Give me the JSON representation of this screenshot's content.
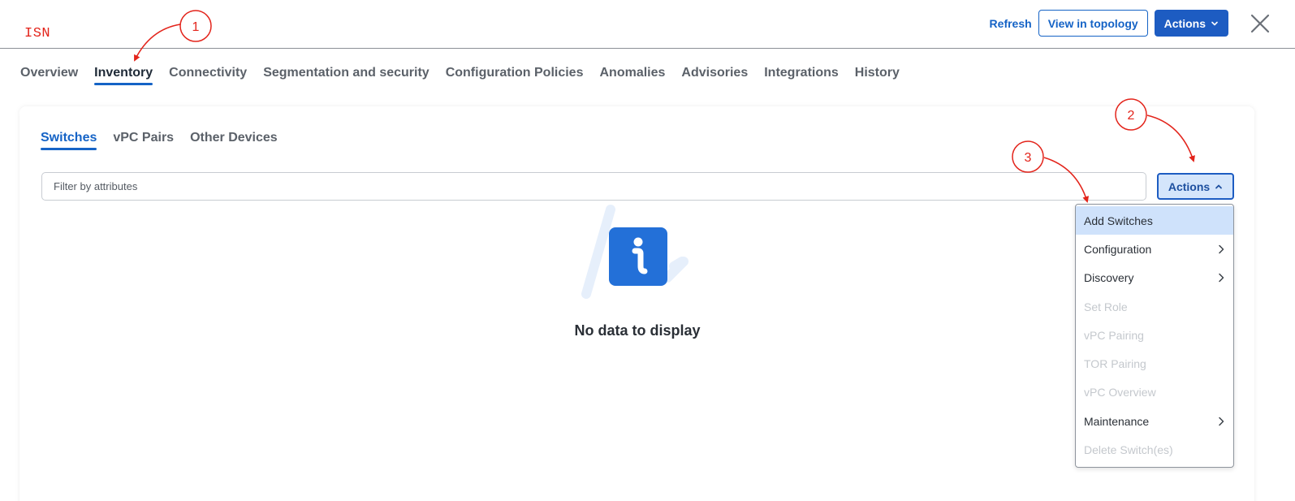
{
  "header": {
    "title": "ISN",
    "refresh_label": "Refresh",
    "view_topology_label": "View in topology",
    "actions_label": "Actions"
  },
  "main_tabs": [
    {
      "label": "Overview",
      "active": false
    },
    {
      "label": "Inventory",
      "active": true
    },
    {
      "label": "Connectivity",
      "active": false
    },
    {
      "label": "Segmentation and security",
      "active": false
    },
    {
      "label": "Configuration Policies",
      "active": false
    },
    {
      "label": "Anomalies",
      "active": false
    },
    {
      "label": "Advisories",
      "active": false
    },
    {
      "label": "Integrations",
      "active": false
    },
    {
      "label": "History",
      "active": false
    }
  ],
  "sub_tabs": [
    {
      "label": "Switches",
      "active": true
    },
    {
      "label": "vPC Pairs",
      "active": false
    },
    {
      "label": "Other Devices",
      "active": false
    }
  ],
  "filter": {
    "placeholder": "Filter by attributes",
    "value": ""
  },
  "actions_button": {
    "label": "Actions",
    "expanded": true
  },
  "actions_menu": [
    {
      "label": "Add Switches",
      "state": "highlighted",
      "submenu": false
    },
    {
      "label": "Configuration",
      "state": "enabled",
      "submenu": true
    },
    {
      "label": "Discovery",
      "state": "enabled",
      "submenu": true
    },
    {
      "label": "Set Role",
      "state": "disabled",
      "submenu": false
    },
    {
      "label": "vPC Pairing",
      "state": "disabled",
      "submenu": false
    },
    {
      "label": "TOR Pairing",
      "state": "disabled",
      "submenu": false
    },
    {
      "label": "vPC Overview",
      "state": "disabled",
      "submenu": false
    },
    {
      "label": "Maintenance",
      "state": "enabled",
      "submenu": true
    },
    {
      "label": "Delete Switch(es)",
      "state": "disabled",
      "submenu": false
    }
  ],
  "empty_state": {
    "icon": "info-icon",
    "message": "No data to display"
  },
  "annotations": [
    {
      "number": "1"
    },
    {
      "number": "2"
    },
    {
      "number": "3"
    }
  ],
  "colors": {
    "accent": "#1563c6",
    "primary_button": "#1d5cc2",
    "menu_highlight": "#cfe2fb",
    "annotation": "#e3241b",
    "title": "#e3241b"
  }
}
